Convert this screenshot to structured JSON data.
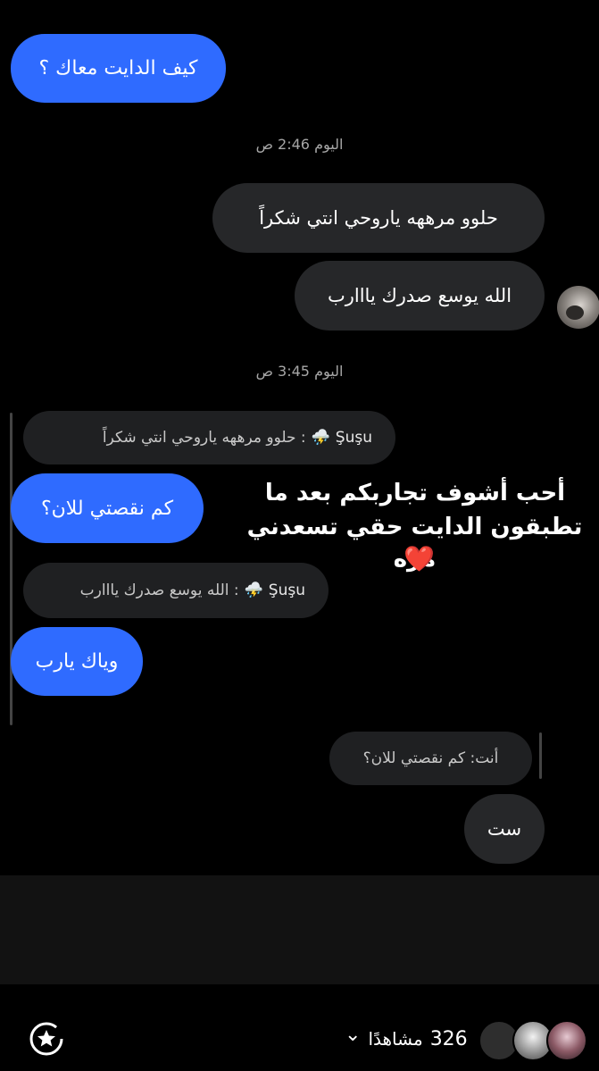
{
  "messages": {
    "m1": "كيف الدايت معاك ؟",
    "ts1": "اليوم 2:46 ص",
    "m2": "حلوو مرههه ياروحي انتي شكراً",
    "m3": "الله يوسع صدرك يااارب",
    "ts2": "اليوم 3:45 ص",
    "reply1": {
      "name": "Şuşu",
      "emoji": "⛈️",
      "text": ": حلوو مرههه ياروحي انتي شكراً"
    },
    "m4": "كم نقصتي للان؟",
    "reply2": {
      "name": "Şuşu",
      "emoji": "⛈️",
      "text": ": الله يوسع صدرك يااارب"
    },
    "m5": "وياك يارب",
    "reply3": {
      "text": "أنت: كم نقصتي للان؟"
    },
    "m6": "ست"
  },
  "overlay": {
    "line1": "أحب أشوف تجاربكم بعد ما",
    "line2": "تطبقون الدايت حقي تسعدني مره",
    "heart": "❤️"
  },
  "footer": {
    "views_count": "326",
    "views_label": "مشاهدًا",
    "chevron": "⌄"
  },
  "colors": {
    "accent_blue": "#2f6bff",
    "bubble_gray": "#262729",
    "background": "#000000"
  },
  "icons": [
    "avatar",
    "story-star-icon",
    "chevron-down-icon",
    "viewer-avatars"
  ]
}
